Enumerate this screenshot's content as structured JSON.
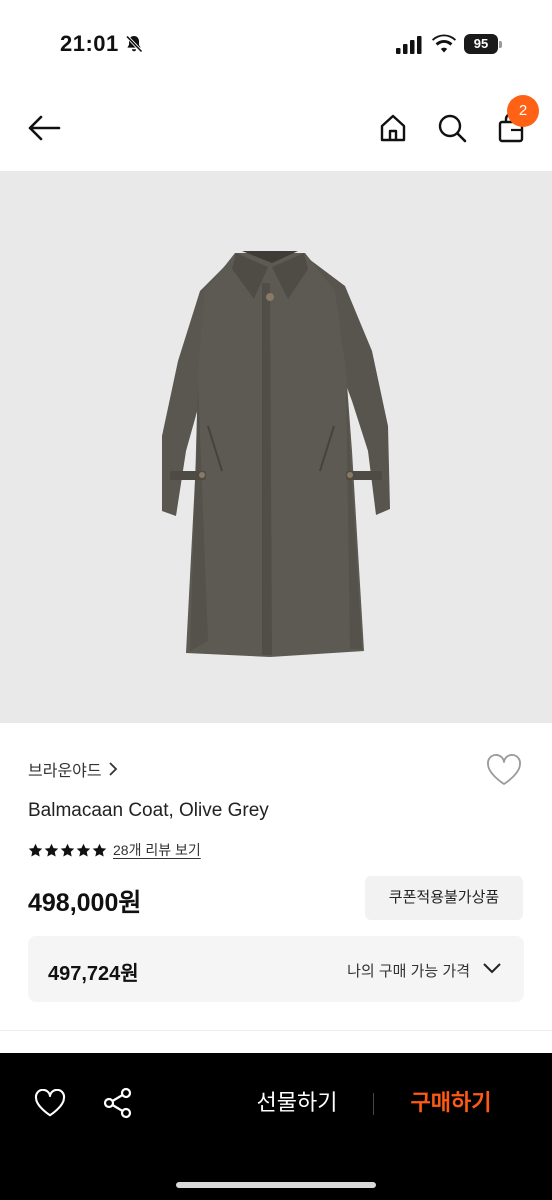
{
  "status_bar": {
    "time": "21:01",
    "battery": "95",
    "icons": [
      "bell-slash-icon",
      "signal-icon",
      "wifi-icon",
      "battery-icon"
    ]
  },
  "nav": {
    "icons": [
      "arrow-left-icon",
      "home-icon",
      "search-icon",
      "shopping-bag-icon"
    ],
    "cart_count": "2"
  },
  "product": {
    "image": "olive grey balmacaan coat",
    "brand": "브라운야드",
    "name": "Balmacaan Coat, Olive Grey",
    "rating_stars": 5,
    "review_link": "28개 리뷰 보기",
    "price": "498,000원",
    "coupon_badge": "쿠폰적용불가상품",
    "my_price": {
      "value": "497,724원",
      "label": "나의 구매 가능 가격"
    }
  },
  "bottom_bar": {
    "icons": [
      "heart-icon",
      "share-icon"
    ],
    "gift_label": "선물하기",
    "buy_label": "구매하기"
  },
  "colors": {
    "accent": "#ff6115",
    "buy_text": "#ff5a14",
    "bottom_bar_bg": "#000000",
    "image_bg": "#e9e9e9"
  }
}
